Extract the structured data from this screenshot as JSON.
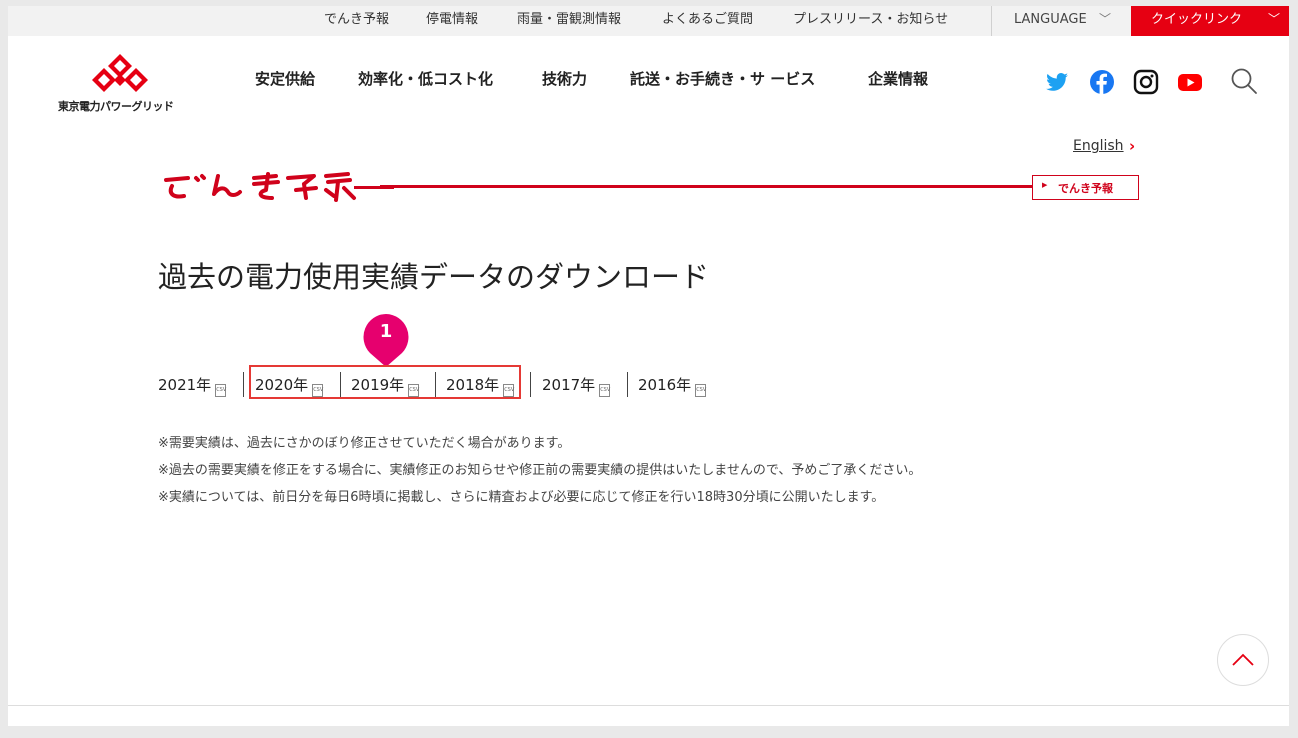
{
  "topbar": {
    "links": [
      "でんき予報",
      "停電情報",
      "雨量・雷観測情報",
      "よくあるご質問",
      "プレスリリース・お知らせ"
    ],
    "language": "LANGUAGE",
    "quick_links": "クイックリンク"
  },
  "logo": {
    "text": "東京電力パワーグリッド"
  },
  "main_nav": [
    "安定供給",
    "効率化・低コスト化",
    "技術力",
    "託送・お手続き・サ ービス",
    "企業情報"
  ],
  "social_icons": [
    "twitter-icon",
    "facebook-icon",
    "instagram-icon",
    "youtube-icon"
  ],
  "english_link": "English",
  "banner": {
    "label": "でんき予報"
  },
  "page_title": "過去の電力使用実績データのダウンロード",
  "years": [
    "2021年",
    "2020年",
    "2019年",
    "2018年",
    "2017年",
    "2016年"
  ],
  "csv_badge": "CSV",
  "marker": "1",
  "notes": [
    "※需要実績は、過去にさかのぼり修正させていただく場合があります。",
    "※過去の需要実績を修正をする場合に、実績修正のお知らせや修正前の需要実績の提供はいたしませんので、予めご了承ください。",
    "※実績については、前日分を毎日6時頃に掲載し、さらに精査および必要に応じて修正を行い18時30分頃に公開いたします。"
  ],
  "colors": {
    "brand_red": "#e60012",
    "highlight": "#e53935",
    "marker": "#e6006e"
  }
}
